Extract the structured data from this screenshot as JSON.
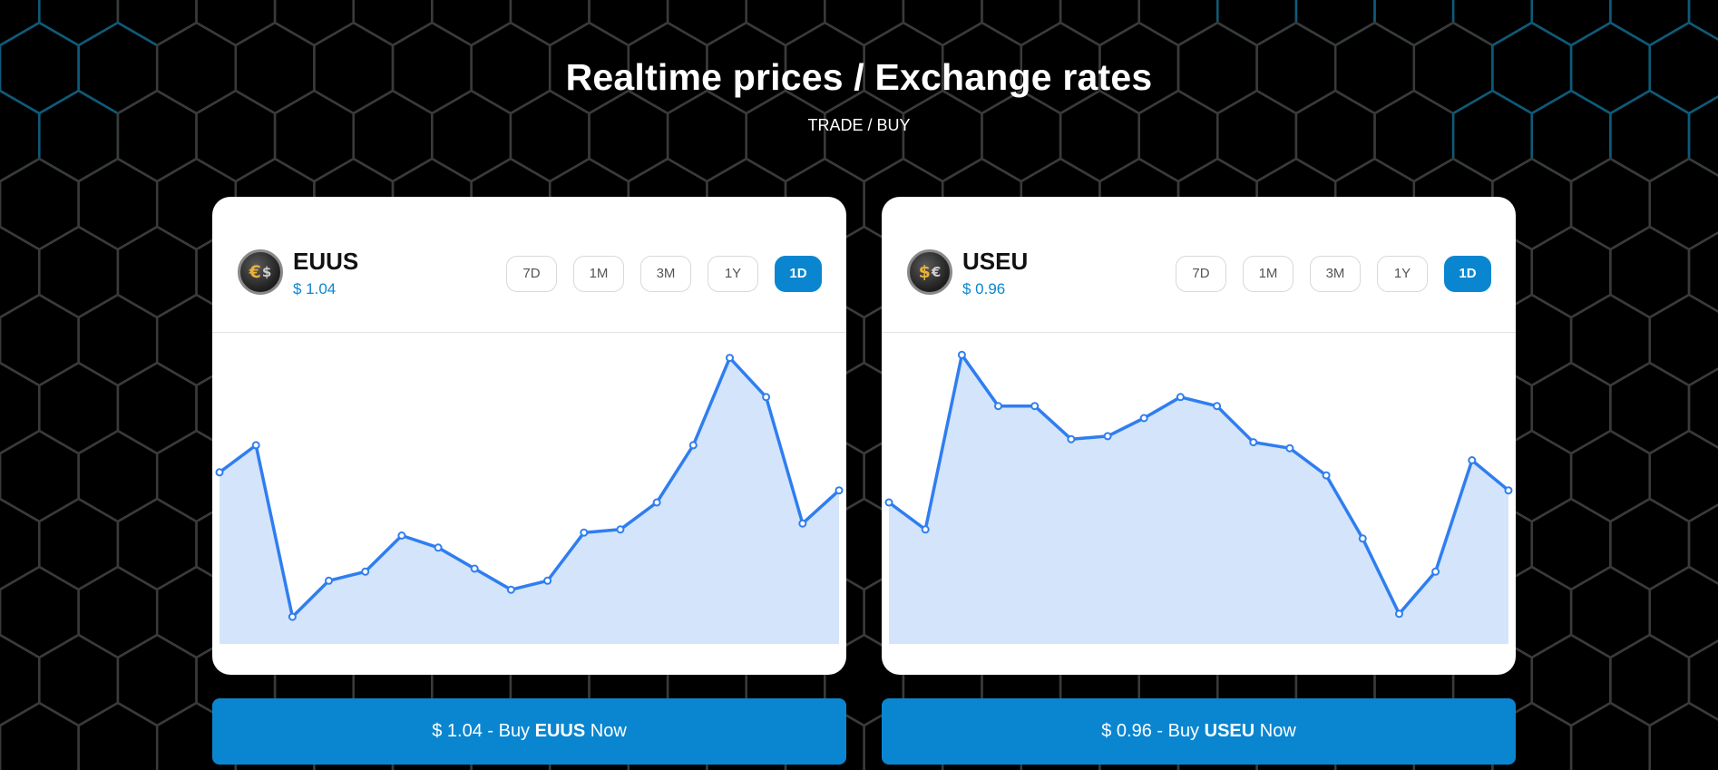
{
  "header": {
    "title": "Realtime prices / Exchange rates",
    "subtitle": "TRADE / BUY"
  },
  "colors": {
    "background": "#000000",
    "accent": "#0a86d0",
    "line": "#2f7ef0",
    "fill": "#d4e4fb",
    "hex_grid": "#3a3a3a",
    "hex_glow": "#0e5a78"
  },
  "ranges": [
    "7D",
    "1M",
    "3M",
    "1Y",
    "1D"
  ],
  "cards": [
    {
      "symbol": "EUUS",
      "price": "$ 1.04",
      "icon": "euro-dollar-coin-icon",
      "active_range": "1D",
      "buy": {
        "prefix": "$ 1.04 - Buy ",
        "symbol": "EUUS",
        "suffix": " Now"
      }
    },
    {
      "symbol": "USEU",
      "price": "$ 0.96",
      "icon": "dollar-euro-coin-icon",
      "active_range": "1D",
      "buy": {
        "prefix": "$ 0.96 - Buy ",
        "symbol": "USEU",
        "suffix": " Now"
      }
    }
  ],
  "chart_data": [
    {
      "type": "area",
      "title": "",
      "xlabel": "",
      "ylabel": "",
      "grid": false,
      "ylim": [
        0,
        100
      ],
      "x": [
        1,
        2,
        3,
        4,
        5,
        6,
        7,
        8,
        9,
        10,
        11,
        12,
        13,
        14,
        15,
        16,
        17,
        18
      ],
      "series": [
        {
          "values": [
            57,
            66,
            9,
            21,
            24,
            36,
            32,
            25,
            18,
            21,
            37,
            38,
            47,
            66,
            95,
            82,
            40,
            51
          ]
        }
      ]
    },
    {
      "type": "area",
      "title": "",
      "xlabel": "",
      "ylabel": "",
      "grid": false,
      "ylim": [
        0,
        100
      ],
      "x": [
        1,
        2,
        3,
        4,
        5,
        6,
        7,
        8,
        9,
        10,
        11,
        12,
        13,
        14,
        15,
        16,
        17,
        18
      ],
      "series": [
        {
          "values": [
            47,
            38,
            96,
            79,
            79,
            68,
            69,
            75,
            82,
            79,
            67,
            65,
            56,
            35,
            10,
            24,
            61,
            51
          ]
        }
      ]
    }
  ]
}
